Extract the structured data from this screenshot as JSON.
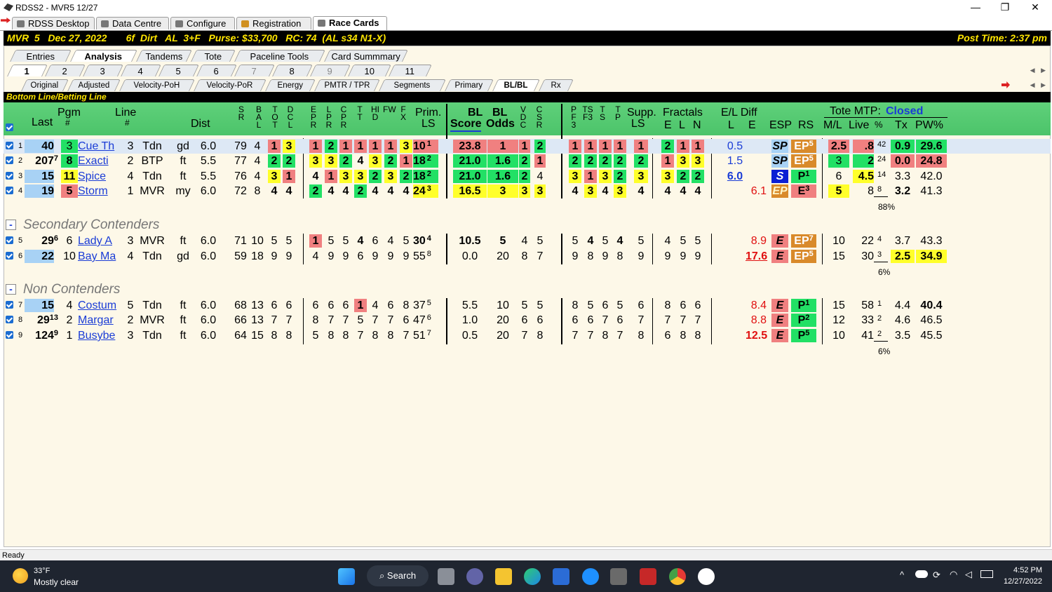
{
  "window": {
    "title": "RDSS2 - MVR5  12/27",
    "minimize": "—",
    "maximize": "❐",
    "close": "✕"
  },
  "app_tabs": [
    "RDSS Desktop",
    "Data Centre",
    "Configure",
    "Registration",
    "Race Cards"
  ],
  "race_info": {
    "left": "MVR  5   Dec 27, 2022       6f  Dirt   AL  3+F   Purse: $33,700   RC: 74  (AL s34 N1-X)",
    "right": "Post Time: 2:37 pm"
  },
  "view_tabs": [
    "Entries",
    "Analysis",
    "Tandems",
    "Tote",
    "Paceline Tools",
    "Card Summmary"
  ],
  "race_tabs": [
    "1",
    "2",
    "3",
    "4",
    "5",
    "6",
    "7",
    "8",
    "9",
    "10",
    "11"
  ],
  "sub_tabs": [
    "Original",
    "Adjusted",
    "Velocity-PoH",
    "Velocity-PoR",
    "Energy",
    "PMTR / TPR",
    "Segments",
    "Primary",
    "BL/BL",
    "Rx"
  ],
  "section_title": "Bottom Line/Betting Line",
  "headers": {
    "last": "Last",
    "pgm": "Pgm",
    "pgm2": "#",
    "line": "Line",
    "line2": "#",
    "dist": "Dist",
    "sr": "SR",
    "bal": "BAL",
    "tot": "TOT",
    "dcl": "DCL",
    "epr": "EPR",
    "lpr": "LPR",
    "cpr": "CPR",
    "tt": "T T",
    "hid": "HID",
    "fw": "FW",
    "fx": "FX",
    "prim": "Prim.",
    "prim2": "LS",
    "bl": "BL",
    "blscore": "Score",
    "bl2": "BL",
    "blodds": "Odds",
    "vdc": "VDC",
    "csr": "CSR",
    "pf3": "PF3",
    "tsf3": "TSF3",
    "ts": "TS",
    "tp": "TP",
    "supp": "Supp.",
    "supp2": "LS",
    "fractals": "Fractals",
    "fe": "E",
    "fl": "L",
    "fn": "N",
    "eldiff": "E/L Diff",
    "ell": "L",
    "ele": "E",
    "esp": "ESP",
    "rs": "RS",
    "tote": "Tote MTP:",
    "tote_status": "Closed",
    "ml": "M/L",
    "live": "Live",
    "pct": "%",
    "tx": "Tx",
    "pw": "PW%"
  },
  "groups": {
    "secondary": "Secondary Contenders",
    "non": "Non Contenders",
    "collapse": "-"
  },
  "rows": [
    {
      "idx": "1",
      "last": "40",
      "pgm": "3",
      "name": "Cue Th",
      "line": "3",
      "trk": "Tdn",
      "cond": "gd",
      "dist": "6.0",
      "sr": "79",
      "bal": "4",
      "tot": "1",
      "dcl": "3",
      "e": "1",
      "l": "2",
      "cp": "1",
      "t": "1",
      "h": "1",
      "f": "1",
      "fx": "3",
      "prim": "10",
      "primsup": "1",
      "bls": "23.8",
      "blo": "1",
      "vdc": "1",
      "csr": "2",
      "pf": "1",
      "ts": "1",
      "ts2": "1",
      "tp": "1",
      "supp": "1",
      "fe": "2",
      "fl": "1",
      "fn": "1",
      "ell": "0.5",
      "ele": "",
      "esp": "SP",
      "rs": "EP",
      "rssup": "5",
      "ml": "2.5",
      "live": ".8",
      "pct": "42",
      "tx": "0.9",
      "pw": "29.6"
    },
    {
      "idx": "2",
      "last": "207",
      "lastsup": "7",
      "pgm": "8",
      "name": "Exacti",
      "line": "2",
      "trk": "BTP",
      "cond": "ft",
      "dist": "5.5",
      "sr": "77",
      "bal": "4",
      "tot": "2",
      "dcl": "2",
      "e": "3",
      "l": "3",
      "cp": "2",
      "t": "4",
      "h": "3",
      "f": "2",
      "fx": "1",
      "prim": "18",
      "primsup": "2",
      "bls": "21.0",
      "blo": "1.6",
      "vdc": "2",
      "csr": "1",
      "pf": "2",
      "ts": "2",
      "ts2": "2",
      "tp": "2",
      "supp": "2",
      "fe": "1",
      "fl": "3",
      "fn": "3",
      "ell": "1.5",
      "ele": "",
      "esp": "SP",
      "rs": "EP",
      "rssup": "5",
      "ml": "3",
      "live": "2",
      "pct": "24",
      "tx": "0.0",
      "pw": "24.8"
    },
    {
      "idx": "3",
      "last": "15",
      "pgm": "11",
      "name": "Spice",
      "line": "4",
      "trk": "Tdn",
      "cond": "ft",
      "dist": "5.5",
      "sr": "76",
      "bal": "4",
      "tot": "3",
      "dcl": "1",
      "e": "4",
      "l": "1",
      "cp": "3",
      "t": "3",
      "h": "2",
      "f": "3",
      "fx": "2",
      "prim": "18",
      "primsup": "2",
      "bls": "21.0",
      "blo": "1.6",
      "vdc": "2",
      "csr": "4",
      "pf": "3",
      "ts": "1",
      "ts2": "3",
      "tp": "2",
      "supp": "3",
      "fe": "3",
      "fl": "2",
      "fn": "2",
      "ell": "6.0",
      "ele": "",
      "esp": "S",
      "rs": "P",
      "rssup": "1",
      "ml": "6",
      "live": "4.5",
      "pct": "14",
      "tx": "3.3",
      "pw": "42.0"
    },
    {
      "idx": "4",
      "last": "19",
      "pgm": "5",
      "name": "Storm",
      "line": "1",
      "trk": "MVR",
      "cond": "my",
      "dist": "6.0",
      "sr": "72",
      "bal": "8",
      "tot": "4",
      "dcl": "4",
      "e": "2",
      "l": "4",
      "cp": "4",
      "t": "2",
      "h": "4",
      "f": "4",
      "fx": "4",
      "prim": "24",
      "primsup": "3",
      "bls": "16.5",
      "blo": "3",
      "vdc": "3",
      "csr": "3",
      "pf": "4",
      "ts": "3",
      "ts2": "4",
      "tp": "3",
      "supp": "4",
      "fe": "4",
      "fl": "4",
      "fn": "4",
      "ell": "",
      "ele": "6.1",
      "esp": "EP",
      "rs": "E",
      "rssup": "3",
      "ml": "5",
      "live": "8",
      "pct": "8",
      "tx": "3.2",
      "pw": "41.3",
      "pctsum": "88%"
    },
    {
      "idx": "5",
      "last": "29",
      "lastsup": "6",
      "pgm": "6",
      "name": "Lady A",
      "line": "3",
      "trk": "MVR",
      "cond": "ft",
      "dist": "6.0",
      "sr": "71",
      "bal": "10",
      "tot": "5",
      "dcl": "5",
      "e": "1",
      "l": "5",
      "cp": "5",
      "t": "4",
      "h": "6",
      "f": "4",
      "fx": "5",
      "prim": "30",
      "primsup": "4",
      "bls": "10.5",
      "blo": "5",
      "vdc": "4",
      "csr": "5",
      "pf": "5",
      "ts": "4",
      "ts2": "5",
      "tp": "4",
      "supp": "5",
      "fe": "4",
      "fl": "5",
      "fn": "5",
      "ell": "",
      "ele": "8.9",
      "esp": "E",
      "rs": "EP",
      "rssup": "7",
      "ml": "10",
      "live": "22",
      "pct": "4",
      "tx": "3.7",
      "pw": "43.3"
    },
    {
      "idx": "6",
      "last": "22",
      "pgm": "10",
      "name": "Bay Ma",
      "line": "4",
      "trk": "Tdn",
      "cond": "gd",
      "dist": "6.0",
      "sr": "59",
      "bal": "18",
      "tot": "9",
      "dcl": "9",
      "e": "4",
      "l": "9",
      "cp": "9",
      "t": "6",
      "h": "9",
      "f": "9",
      "fx": "9",
      "prim": "55",
      "primsup": "8",
      "bls": "0.0",
      "blo": "20",
      "vdc": "8",
      "csr": "7",
      "pf": "9",
      "ts": "8",
      "ts2": "9",
      "tp": "8",
      "supp": "9",
      "fe": "9",
      "fl": "9",
      "fn": "9",
      "ell": "",
      "ele": "17.6",
      "esp": "E",
      "rs": "EP",
      "rssup": "5",
      "ml": "15",
      "live": "30",
      "pct": "3",
      "tx": "2.5",
      "pw": "34.9",
      "pctsum": "6%"
    },
    {
      "idx": "7",
      "last": "15",
      "pgm": "4",
      "name": "Costum",
      "line": "5",
      "trk": "Tdn",
      "cond": "ft",
      "dist": "6.0",
      "sr": "68",
      "bal": "13",
      "tot": "6",
      "dcl": "6",
      "e": "6",
      "l": "6",
      "cp": "6",
      "t": "1",
      "h": "4",
      "f": "6",
      "fx": "8",
      "prim": "37",
      "primsup": "5",
      "bls": "5.5",
      "blo": "10",
      "vdc": "5",
      "csr": "5",
      "pf": "8",
      "ts": "5",
      "ts2": "6",
      "tp": "5",
      "supp": "6",
      "fe": "8",
      "fl": "6",
      "fn": "6",
      "ell": "",
      "ele": "8.4",
      "esp": "E",
      "rs": "P",
      "rssup": "1",
      "ml": "15",
      "live": "58",
      "pct": "1",
      "tx": "4.4",
      "pw": "40.4"
    },
    {
      "idx": "8",
      "last": "29",
      "lastsup": "13",
      "pgm": "2",
      "name": "Margar",
      "line": "2",
      "trk": "MVR",
      "cond": "ft",
      "dist": "6.0",
      "sr": "66",
      "bal": "13",
      "tot": "7",
      "dcl": "7",
      "e": "8",
      "l": "7",
      "cp": "7",
      "t": "5",
      "h": "7",
      "f": "7",
      "fx": "6",
      "prim": "47",
      "primsup": "6",
      "bls": "1.0",
      "blo": "20",
      "vdc": "6",
      "csr": "6",
      "pf": "6",
      "ts": "6",
      "ts2": "7",
      "tp": "6",
      "supp": "7",
      "fe": "7",
      "fl": "7",
      "fn": "7",
      "ell": "",
      "ele": "8.8",
      "esp": "E",
      "rs": "P",
      "rssup": "2",
      "ml": "12",
      "live": "33",
      "pct": "2",
      "tx": "4.6",
      "pw": "46.5"
    },
    {
      "idx": "9",
      "last": "124",
      "lastsup": "9",
      "pgm": "1",
      "name": "Busybe",
      "line": "3",
      "trk": "Tdn",
      "cond": "ft",
      "dist": "6.0",
      "sr": "64",
      "bal": "15",
      "tot": "8",
      "dcl": "8",
      "e": "5",
      "l": "8",
      "cp": "8",
      "t": "7",
      "h": "8",
      "f": "8",
      "fx": "7",
      "prim": "51",
      "primsup": "7",
      "bls": "0.5",
      "blo": "20",
      "vdc": "7",
      "csr": "8",
      "pf": "7",
      "ts": "7",
      "ts2": "8",
      "tp": "7",
      "supp": "8",
      "fe": "6",
      "fl": "8",
      "fn": "8",
      "ell": "",
      "ele": "12.5",
      "esp": "E",
      "rs": "P",
      "rssup": "5",
      "ml": "10",
      "live": "41",
      "pct": "2",
      "tx": "3.5",
      "pw": "45.5",
      "pctsum": "6%"
    }
  ],
  "status": "Ready",
  "taskbar": {
    "temp": "33°F",
    "weather": "Mostly clear",
    "search": "Search",
    "time": "4:52 PM",
    "date": "12/27/2022"
  },
  "colors": {
    "green": "#22e065",
    "yellow": "#ffff2a",
    "pink": "#f08080",
    "blue": "#a8d2f5",
    "orange": "#d98a2a",
    "darkblue": "#0b1fd4"
  }
}
